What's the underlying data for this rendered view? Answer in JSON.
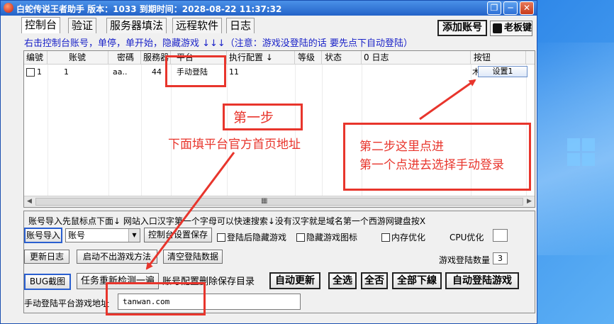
{
  "window": {
    "title": "白蛇传说王者助手 版本：1033 到期时间：2028-08-22 11:37:32",
    "controls": {
      "restore": "❐",
      "minimize": "─",
      "close": "✕"
    }
  },
  "tabs": [
    "控制台",
    "验证",
    "服务器填法",
    "远程软件",
    "日志"
  ],
  "header_buttons": {
    "add_account": "添加账号",
    "boss_key": "老板键"
  },
  "hint_line": "右击控制台账号，单停，单开始，隐藏游戏 ↓↓↓（注意：游戏没登陆的话 要先点下自动登陆）",
  "grid": {
    "columns": [
      "编號",
      "账號",
      "密碼",
      "服務器",
      "平台",
      "执行配置 ↓",
      "等级",
      "状态",
      "0 日志",
      "按钮"
    ],
    "rows": [
      {
        "id": "1",
        "account": "1",
        "password": "aa..",
        "server": "44",
        "platform": "手动登陆",
        "config": "11",
        "extra": "木",
        "button": "设置1"
      }
    ],
    "scroll_glyph": "▦"
  },
  "panel": {
    "hint": "账号导入先鼠标点下面↓ 网站入口汉字第一个字母可以快速搜索↓没有汉字就是域名第一个西游网键盘按X",
    "import_button": "账号导入",
    "select_value": "账号",
    "select_arrow": "▼",
    "console_settings_save": "控制台设置保存",
    "hide_after_login": "登陆后隐藏游戏",
    "hide_game_icon": "隐藏游戏图标",
    "memory_opt": "内存优化",
    "cpu_opt": "CPU优化",
    "update_log": "更新日志",
    "launch_method": "启动不出游戏方法",
    "clear_login_data": "清空登陆数据",
    "game_login_count_label": "游戏登陆数量",
    "game_login_count": "3",
    "bug_screenshot": "BUG截图",
    "recheck_tasks": "任务重新检测一遍",
    "account_config_label": "账号配置删除保存目录",
    "auto_update": "自动更新",
    "select_all": "全选",
    "select_none": "全否",
    "all_offline": "全部下線",
    "auto_login_game": "自动登陆游戏",
    "manual_login_label": "手动登陆平台游戏地址",
    "manual_login_address": "tanwan.com"
  },
  "annotations": {
    "step1": "第一步",
    "step1_detail": "下面填平台官方首页地址",
    "step2_line1": "第二步这里点进",
    "step2_line2": "第一个点进去选择手动登录",
    "color": "#e8352c"
  },
  "colors": {
    "hint_text": "#1a22c8",
    "titlebar": "#2463c8",
    "desktop": "#1e6fd0"
  }
}
